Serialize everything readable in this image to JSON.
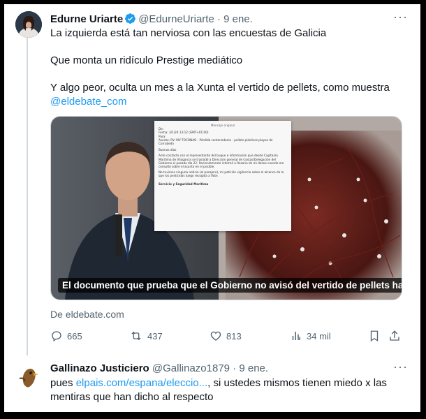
{
  "tweet1": {
    "name": "Edurne Uriarte",
    "handle": "@EdurneUriarte",
    "date": "· 9 ene.",
    "line1": "La izquierda está tan nerviosa con las encuestas de Galicia",
    "line2": "Que monta un ridículo Prestige mediático",
    "line3": "Y algo peor, oculta un mes a la Xunta el vertido de pellets, como muestra",
    "mention": "@eldebate_com",
    "media_caption": "El documento que prueba que el Gobierno no avisó del vertido de pellets hasta ...",
    "source": "De eldebate.com",
    "replies": "665",
    "retweets": "437",
    "likes": "813",
    "views": "34 mil",
    "doc": {
      "header": "Mensaje original",
      "from": "De: ",
      "date": "Fecha: 3/1/24 13:12 (GMT+01:00)",
      "to": "Para: ",
      "subject": "Asunto: RV: MV TOCONAO - Pérdida contenedores - pellets plásticos playas de Corrubedo",
      "greeting": "Buenos días",
      "p1": "Ante contacto con el representante del buque e información que desde Capitanía Marítima de Vilagarcía se trasladó a Dirección general de Costas/Delegación del Gobierno el pasado día 22. Recientemente informé a Rosario de mi deseo cuando me consultó sobre el asunto en el posible.",
      "p2": "No tuvimos ninguna noticia (el pasajero), mi petición vigilancia sobre el alcance de lo que los pesticidas luego recogida a flote.",
      "sign": "Servicio y Seguridad Marítima"
    }
  },
  "tweet2": {
    "name": "Gallinazo Justiciero",
    "handle": "@Gallinazo1879",
    "date": "· 9 ene.",
    "prefix": "pues ",
    "link": "elpais.com/espana/eleccio...",
    "suffix": ", si ustedes mismos tienen miedo x las",
    "line2": "mentiras que han dicho al respecto"
  },
  "colors": {
    "link": "#1d9bf0",
    "verified": "#1d9bf0",
    "secondary_text": "#536471",
    "primary_text": "#0f1419"
  },
  "icons": [
    "more-icon",
    "verified-icon",
    "reply-icon",
    "retweet-icon",
    "like-icon",
    "views-icon",
    "bookmark-icon",
    "share-icon"
  ]
}
